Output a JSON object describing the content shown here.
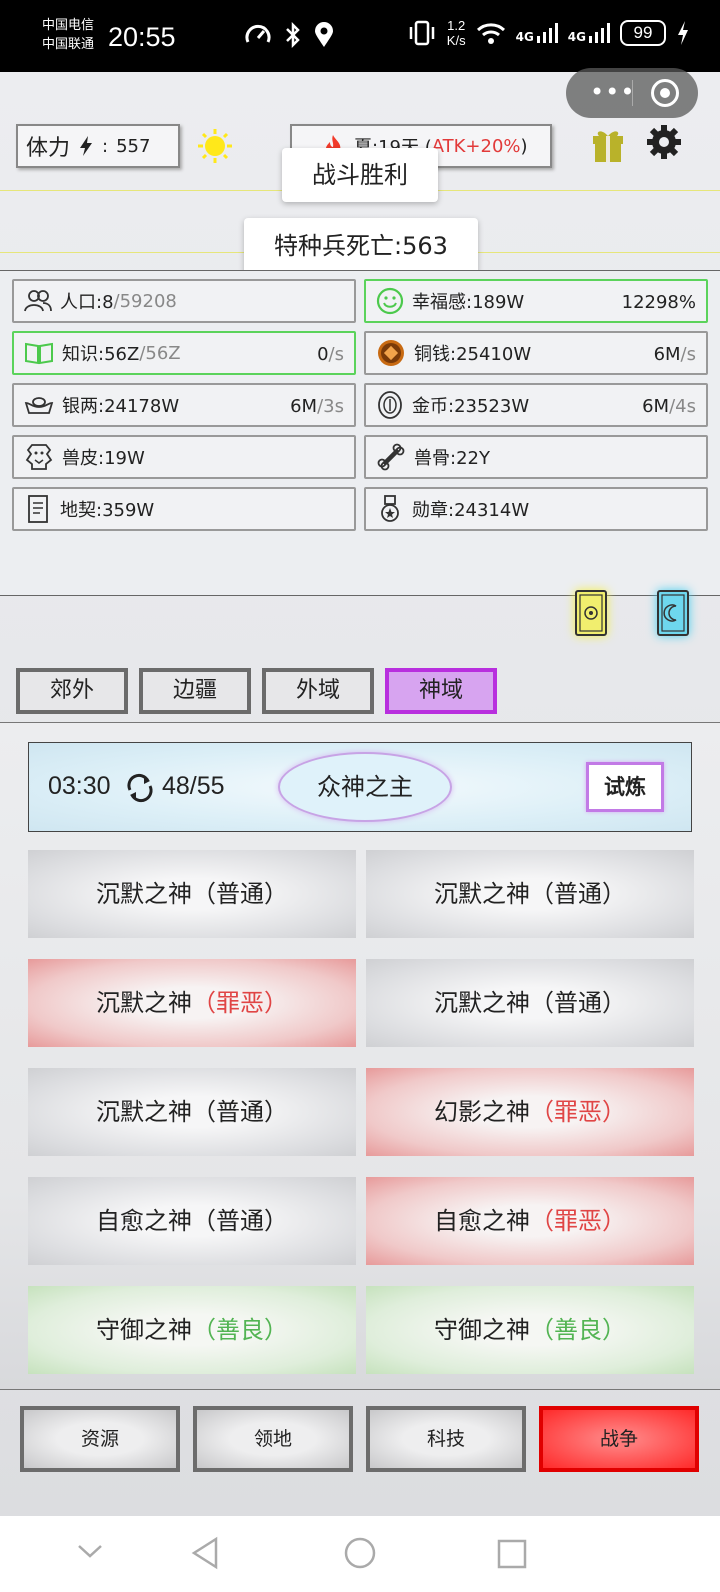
{
  "status_bar": {
    "carrier_1": "中国电信",
    "carrier_2": "中国联通",
    "time": "20:55",
    "speed_value": "1.2",
    "speed_unit": "K/s",
    "network_1": "4G",
    "network_2": "4G",
    "battery": "99"
  },
  "top": {
    "stamina_label": "体力",
    "stamina_sep": ":",
    "stamina_value": "557",
    "season_text": "夏:19天 (",
    "season_bonus": "ATK+20%",
    "season_close": ")"
  },
  "toasts": {
    "victory": "战斗胜利",
    "deaths": "特种兵死亡:563"
  },
  "resources": [
    {
      "label": "人口:8",
      "suffix": "/59208",
      "rate": "",
      "rate_unit": ""
    },
    {
      "label": "幸福感:189W",
      "suffix": "",
      "rate": "12298%",
      "rate_unit": ""
    },
    {
      "label": "知识:56Z",
      "suffix": "/56Z",
      "rate": "0",
      "rate_unit": "/s"
    },
    {
      "label": "铜钱:25410W",
      "suffix": "",
      "rate": "6M",
      "rate_unit": "/s"
    },
    {
      "label": "银两:24178W",
      "suffix": "",
      "rate": "6M",
      "rate_unit": "/3s"
    },
    {
      "label": "金币:23523W",
      "suffix": "",
      "rate": "6M",
      "rate_unit": "/4s"
    },
    {
      "label": "兽皮:19W",
      "suffix": "",
      "rate": "",
      "rate_unit": ""
    },
    {
      "label": "兽骨:22Y",
      "suffix": "",
      "rate": "",
      "rate_unit": ""
    },
    {
      "label": "地契:359W",
      "suffix": "",
      "rate": "",
      "rate_unit": ""
    },
    {
      "label": "勋章:24314W",
      "suffix": "",
      "rate": "",
      "rate_unit": ""
    }
  ],
  "tabs": [
    "郊外",
    "边疆",
    "外域",
    "神域"
  ],
  "active_tab": "神域",
  "boss_bar": {
    "timer": "03:30",
    "count": "48/55",
    "boss_name": "众神之主",
    "trial_label": "试炼"
  },
  "enemies": [
    {
      "name": "沉默之神",
      "tag": "（普通）",
      "kind": "normal"
    },
    {
      "name": "沉默之神",
      "tag": "（普通）",
      "kind": "normal"
    },
    {
      "name": "沉默之神",
      "tag": "（罪恶）",
      "kind": "evil"
    },
    {
      "name": "沉默之神",
      "tag": "（普通）",
      "kind": "normal"
    },
    {
      "name": "沉默之神",
      "tag": "（普通）",
      "kind": "normal"
    },
    {
      "name": "幻影之神",
      "tag": "（罪恶）",
      "kind": "evil"
    },
    {
      "name": "自愈之神",
      "tag": "（普通）",
      "kind": "normal"
    },
    {
      "name": "自愈之神",
      "tag": "（罪恶）",
      "kind": "evil"
    },
    {
      "name": "守御之神",
      "tag": "（善良）",
      "kind": "good"
    },
    {
      "name": "守御之神",
      "tag": "（善良）",
      "kind": "good"
    }
  ],
  "bottom_nav": [
    "资源",
    "领地",
    "科技",
    "战争"
  ],
  "active_nav": "战争",
  "colors": {
    "accent_purple": "#b82fde",
    "war_red": "#ff2a2a",
    "evil_text": "#e04545",
    "good_text": "#53b453",
    "highlight_green": "#5bd35b"
  }
}
